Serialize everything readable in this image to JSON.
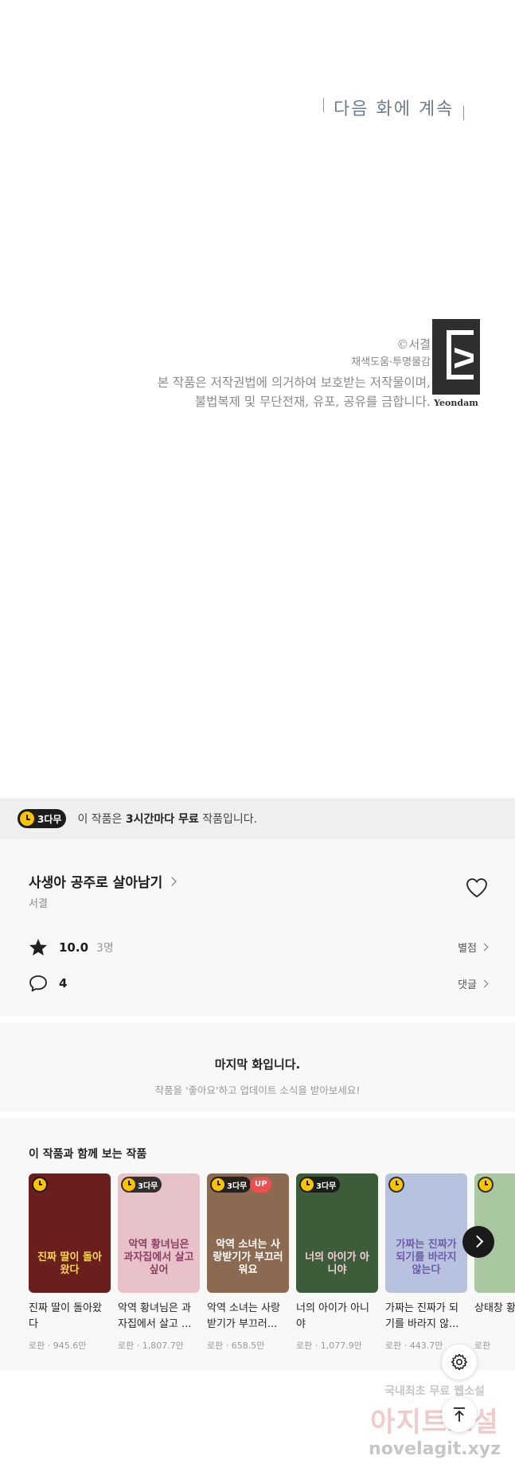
{
  "comic": {
    "next_episode": "다음 화에 계속",
    "copyright_line1": "©서결",
    "copyright_line2": "채색도움·투명물감",
    "copyright_line3": "본 작품은 저작권법에 의거하여 보호받는 저작물이며,",
    "copyright_line4": "불법복제 및 무단전재, 유포, 공유를 금합니다.",
    "logo_text": "Yeondam"
  },
  "free_banner": {
    "badge": "3다무",
    "text_before": "이 작품은 ",
    "text_bold": "3시간마다 무료",
    "text_after": " 작품입니다."
  },
  "work": {
    "title": "사생아 공주로 살아남기",
    "author": "서결",
    "rating": "10.0",
    "rating_count": "3명",
    "rating_link": "별점",
    "comments": "4",
    "comments_link": "댓글"
  },
  "last_episode": {
    "title": "마지막 화입니다.",
    "subtitle": "작품을 '좋아요'하고 업데이트 소식을 받아보세요!"
  },
  "recommendations": {
    "title": "이 작품과 함께 보는 작품",
    "items": [
      {
        "title": "진짜 딸이 돌아왔다",
        "meta": "로판 · 945.6만",
        "badge": "",
        "up": "",
        "art": "진짜 딸이 돌아왔다",
        "bg": "#6b1e1e",
        "art_color": "#ffd65a"
      },
      {
        "title": "악역 황녀님은 과자집에서 살고 ...",
        "meta": "로판 · 1,807.7만",
        "badge": "3다무",
        "up": "",
        "art": "악역 황녀님은 과자집에서 살고 싶어",
        "bg": "#e7c3c9",
        "art_color": "#8a3d62"
      },
      {
        "title": "악역 소녀는 사랑받기가 부끄러...",
        "meta": "로판 · 658.5만",
        "badge": "3다무",
        "up": "UP",
        "art": "악역 소녀는 사랑받기가 부끄러워요",
        "bg": "#8c6a52",
        "art_color": "#ffffff"
      },
      {
        "title": "너의 아이가 아니야",
        "meta": "로판 · 1,077.9만",
        "badge": "3다무",
        "up": "",
        "art": "너의 아이가 아니야",
        "bg": "#3d5c3a",
        "art_color": "#f5d0dc"
      },
      {
        "title": "가짜는 진짜가 되기를 바라지 않...",
        "meta": "로판 · 443.7만",
        "badge": "",
        "up": "",
        "art": "가짜는 진짜가 되기를 바라지 않는다",
        "bg": "#b7c2df",
        "art_color": "#6e5aa8"
      },
      {
        "title": "상태창 황녀",
        "meta": "로판",
        "badge": "",
        "up": "",
        "art": "",
        "bg": "#a9c7a0",
        "art_color": "#ffffff"
      }
    ]
  },
  "watermark": {
    "line1": "국내최초 무료 웹소설",
    "line2": "아지트소설",
    "line3": "novelagit.xyz"
  },
  "colors": {
    "accent_yellow": "#ffc400",
    "up_red": "#f04f4f",
    "banner_bg": "#efefef"
  }
}
